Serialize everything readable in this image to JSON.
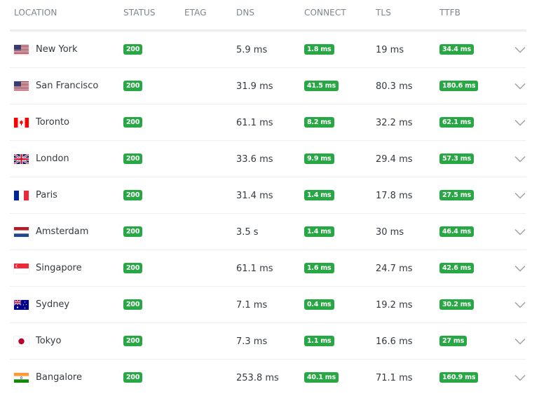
{
  "columns": {
    "location": "LOCATION",
    "status": "STATUS",
    "etag": "ETAG",
    "dns": "DNS",
    "connect": "CONNECT",
    "tls": "TLS",
    "ttfb": "TTFB"
  },
  "colors": {
    "badge_green": "#28a745",
    "header_text": "#7d868f",
    "body_text": "#333a40"
  },
  "rows": [
    {
      "location": "New York",
      "flag": "us-flag-icon",
      "status": "200",
      "etag": "",
      "dns": "5.9 ms",
      "connect": "1.8 ms",
      "tls": "19 ms",
      "ttfb": "34.4 ms"
    },
    {
      "location": "San Francisco",
      "flag": "us-flag-icon",
      "status": "200",
      "etag": "",
      "dns": "31.9 ms",
      "connect": "41.5 ms",
      "tls": "80.3 ms",
      "ttfb": "180.6 ms"
    },
    {
      "location": "Toronto",
      "flag": "ca-flag-icon",
      "status": "200",
      "etag": "",
      "dns": "61.1 ms",
      "connect": "8.2 ms",
      "tls": "32.2 ms",
      "ttfb": "62.1 ms"
    },
    {
      "location": "London",
      "flag": "gb-flag-icon",
      "status": "200",
      "etag": "",
      "dns": "33.6 ms",
      "connect": "9.9 ms",
      "tls": "29.4 ms",
      "ttfb": "57.3 ms"
    },
    {
      "location": "Paris",
      "flag": "fr-flag-icon",
      "status": "200",
      "etag": "",
      "dns": "31.4 ms",
      "connect": "1.4 ms",
      "tls": "17.8 ms",
      "ttfb": "27.5 ms"
    },
    {
      "location": "Amsterdam",
      "flag": "nl-flag-icon",
      "status": "200",
      "etag": "",
      "dns": "3.5 s",
      "connect": "1.4 ms",
      "tls": "30 ms",
      "ttfb": "46.4 ms"
    },
    {
      "location": "Singapore",
      "flag": "sg-flag-icon",
      "status": "200",
      "etag": "",
      "dns": "61.1 ms",
      "connect": "1.6 ms",
      "tls": "24.7 ms",
      "ttfb": "42.6 ms"
    },
    {
      "location": "Sydney",
      "flag": "au-flag-icon",
      "status": "200",
      "etag": "",
      "dns": "7.1 ms",
      "connect": "0.4 ms",
      "tls": "19.2 ms",
      "ttfb": "30.2 ms"
    },
    {
      "location": "Tokyo",
      "flag": "jp-flag-icon",
      "status": "200",
      "etag": "",
      "dns": "7.3 ms",
      "connect": "1.1 ms",
      "tls": "16.6 ms",
      "ttfb": "27 ms"
    },
    {
      "location": "Bangalore",
      "flag": "in-flag-icon",
      "status": "200",
      "etag": "",
      "dns": "253.8 ms",
      "connect": "40.1 ms",
      "tls": "71.1 ms",
      "ttfb": "160.9 ms"
    }
  ]
}
